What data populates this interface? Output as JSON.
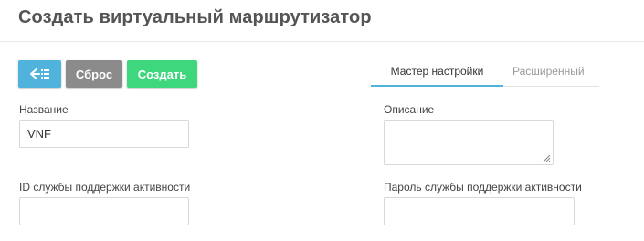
{
  "page": {
    "title": "Создать виртуальный маршрутизатор"
  },
  "toolbar": {
    "back_icon": "arrow-left-list-icon",
    "reset_label": "Сброс",
    "create_label": "Создать"
  },
  "tabs": [
    {
      "label": "Мастер настройки",
      "active": true
    },
    {
      "label": "Расширенный",
      "active": false
    }
  ],
  "form": {
    "name": {
      "label": "Название",
      "value": "VNF"
    },
    "description": {
      "label": "Описание",
      "value": ""
    },
    "keepalive_id": {
      "label": "ID службы поддержки активности",
      "value": ""
    },
    "keepalive_password": {
      "label": "Пароль службы поддержки активности",
      "value": ""
    }
  },
  "colors": {
    "back_button": "#4fb3dc",
    "reset_button": "#8b8b8b",
    "create_button": "#3fd77e",
    "active_tab_underline": "#4fb3dc"
  }
}
